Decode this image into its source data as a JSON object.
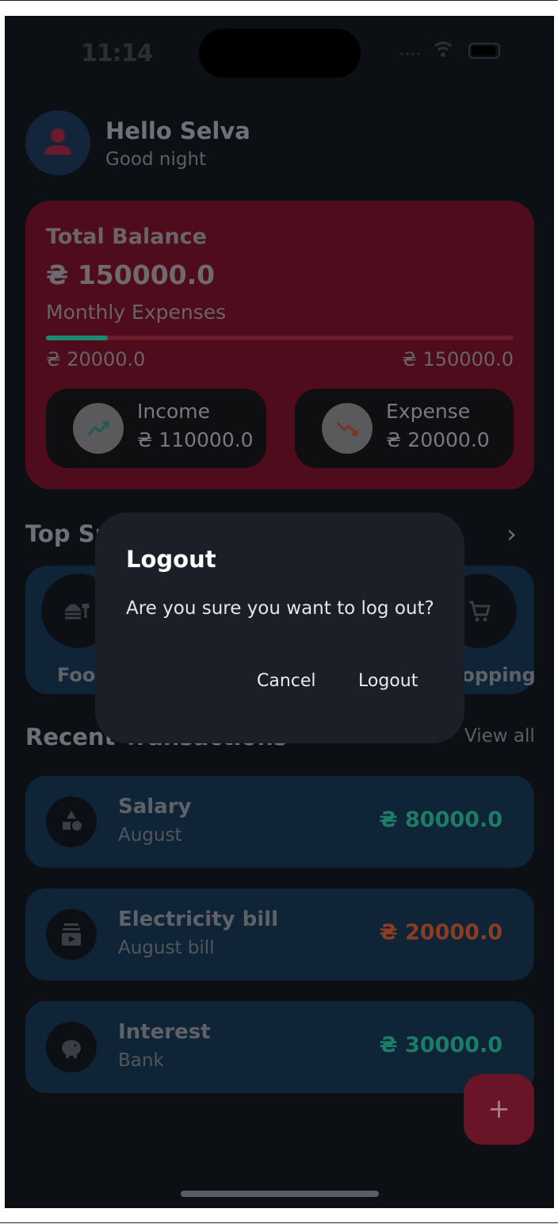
{
  "status": {
    "time": "11:14"
  },
  "header": {
    "hello": "Hello Selva",
    "greeting": "Good night"
  },
  "balance": {
    "total_label": "Total Balance",
    "total_amount": "₴ 150000.0",
    "monthly_label": "Monthly Expenses",
    "progress_fraction": 0.133,
    "spent": "₴ 20000.0",
    "limit": "₴ 150000.0",
    "income_label": "Income",
    "income_value": "₴ 110000.0",
    "expense_label": "Expense",
    "expense_value": "₴ 20000.0"
  },
  "top_spending": {
    "title": "Top Sp",
    "items": [
      {
        "label": "Food",
        "icon": "food-icon"
      },
      {
        "label": "Shopping",
        "icon": "cart-icon"
      }
    ]
  },
  "recent": {
    "title": "Recent Transactions",
    "view_all": "View all",
    "items": [
      {
        "name": "Salary",
        "sub": "August",
        "amount": "₴ 80000.0",
        "icon": "shapes-icon",
        "color": "#1b7d66"
      },
      {
        "name": "Electricity bill",
        "sub": "August bill",
        "amount": "₴ 20000.0",
        "icon": "bill-icon",
        "color": "#8a3d22"
      },
      {
        "name": "Interest",
        "sub": "Bank",
        "amount": "₴ 30000.0",
        "icon": "piggy-bank-icon",
        "color": "#1b7d66"
      }
    ]
  },
  "dialog": {
    "title": "Logout",
    "message": "Are you sure you want to log out?",
    "cancel": "Cancel",
    "confirm": "Logout"
  },
  "colors": {
    "income": "#1b7d66",
    "expense": "#8a3d22",
    "card": "#4e0c1d",
    "accent": "#1b8a72"
  }
}
